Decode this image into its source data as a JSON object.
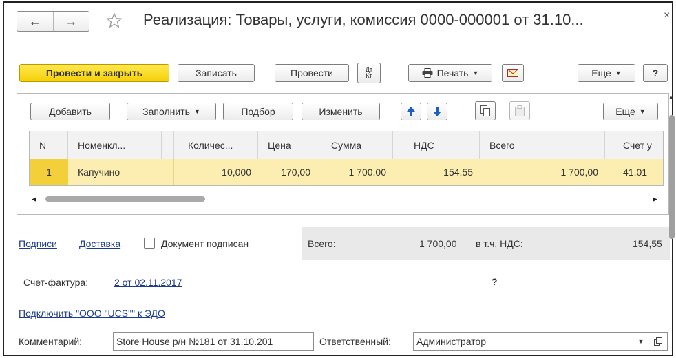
{
  "window": {
    "title": "Реализация: Товары, услуги, комиссия 0000-000001 от 31.10...",
    "close_glyph": "×",
    "back_glyph": "←",
    "forward_glyph": "→"
  },
  "toolbar": {
    "post_and_close": "Провести и закрыть",
    "save": "Записать",
    "post": "Провести",
    "dt_kt": "Дт Кт",
    "print": "Печать",
    "more": "Еще",
    "help": "?"
  },
  "table_toolbar": {
    "add": "Добавить",
    "fill": "Заполнить",
    "select": "Подбор",
    "change": "Изменить",
    "more": "Еще"
  },
  "table": {
    "columns": [
      "N",
      "Номенкл...",
      "Количес...",
      "Цена",
      "Сумма",
      "НДС",
      "Всего",
      "Счет у"
    ],
    "rows": [
      [
        "1",
        "Капучино",
        "10,000",
        "170,00",
        "1 700,00",
        "154,55",
        "1 700,00",
        "41.01"
      ]
    ]
  },
  "footer": {
    "signatures_link": "Подписи",
    "delivery_link": "Доставка",
    "signed_label": "Документ подписан",
    "signed_checked": false,
    "total_label": "Всего:",
    "total_value": "1 700,00",
    "vat_label": "в т.ч. НДС:",
    "vat_value": "154,55",
    "invoice_label": "Счет-фактура:",
    "invoice_link": "2 от 02.11.2017",
    "question": "?",
    "edo_link": "Подключить \"ООО \"UCS\"\" к ЭДО",
    "comment_label": "Комментарий:",
    "comment_value": "Store House р/н №181 от 31.10.201",
    "responsible_label": "Ответственный:",
    "responsible_value": "Администратор"
  },
  "colors": {
    "primary_button": "#f5d10a",
    "selected_row": "#fbeeb0",
    "selected_cell": "#f3cf3a",
    "link": "#1d3d8a",
    "totals_bg": "#e9e9e9"
  },
  "icons": {
    "favorite": "star-icon",
    "print": "printer-icon",
    "mail": "envelope-icon",
    "move_up": "arrow-up-icon",
    "move_down": "arrow-down-icon",
    "copy": "copy-icon",
    "paste": "paste-icon",
    "open": "open-form-icon"
  }
}
